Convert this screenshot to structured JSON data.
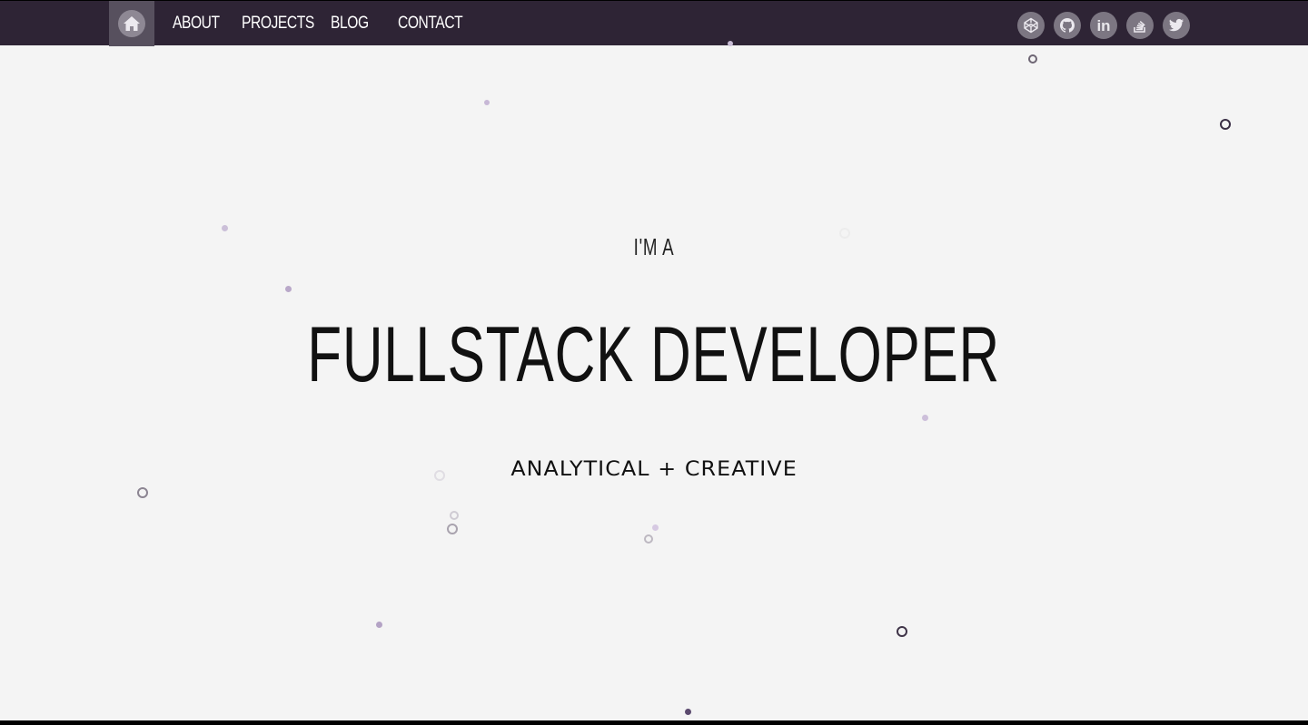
{
  "nav": {
    "home_icon": "home-icon",
    "links": [
      "ABOUT",
      "PROJECTS",
      "BLOG",
      "CONTACT"
    ],
    "social": [
      {
        "name": "codepen",
        "icon": "codepen-icon"
      },
      {
        "name": "github",
        "icon": "github-icon"
      },
      {
        "name": "linkedin",
        "icon": "linkedin-icon",
        "glyph": "in"
      },
      {
        "name": "stackoverflow",
        "icon": "stackoverflow-icon"
      },
      {
        "name": "twitter",
        "icon": "twitter-icon"
      }
    ]
  },
  "hero": {
    "intro": "I'M A",
    "title": "FULLSTACK DEVELOPER",
    "tagline": "ANALYTICAL + CREATIVE"
  },
  "colors": {
    "navbar": "#2e2435",
    "home_active": "#57505e",
    "social_circle": "#7c7682",
    "background": "#f4f4f4",
    "particle_purple": "#b9a8c9",
    "particle_dark": "#3a2f45"
  }
}
